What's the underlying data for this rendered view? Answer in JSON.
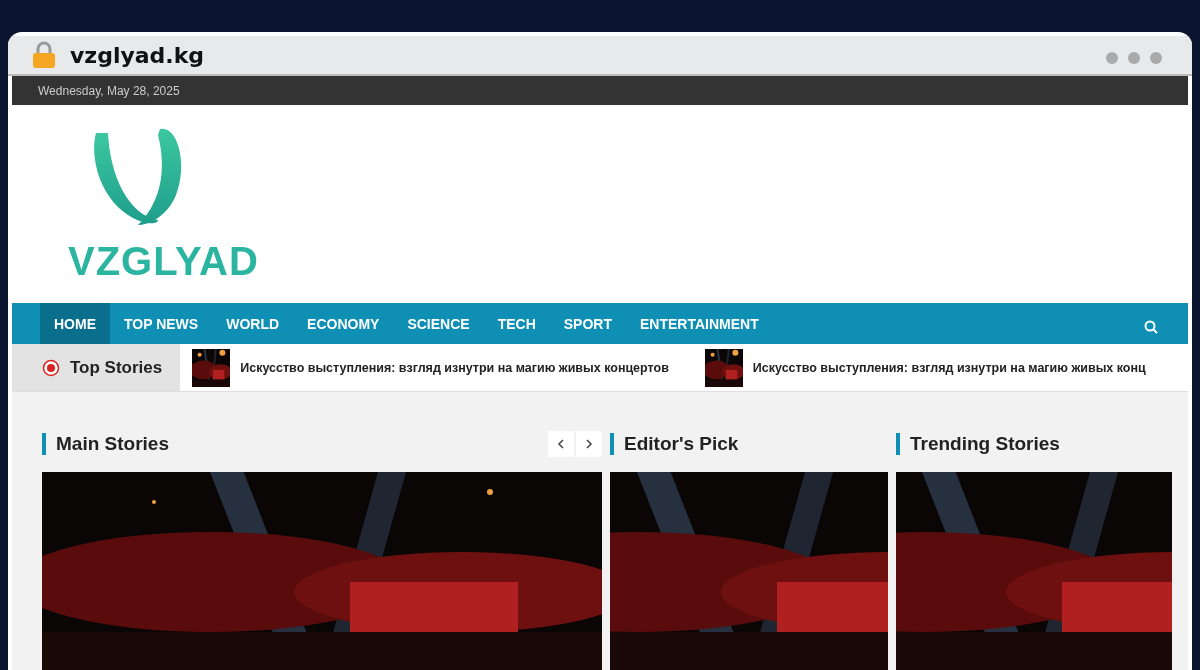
{
  "browser": {
    "url": "vzglyad.kg"
  },
  "top_bar": {
    "date": "Wednesday, May 28, 2025"
  },
  "logo": {
    "text": "VZGLYAD"
  },
  "nav": {
    "items": [
      {
        "label": "HOME",
        "selected": true
      },
      {
        "label": "TOP NEWS",
        "selected": false
      },
      {
        "label": "WORLD",
        "selected": false
      },
      {
        "label": "ECONOMY",
        "selected": false
      },
      {
        "label": "SCIENCE",
        "selected": false
      },
      {
        "label": "TECH",
        "selected": false
      },
      {
        "label": "SPORT",
        "selected": false
      },
      {
        "label": "ENTERTAINMENT",
        "selected": false
      }
    ]
  },
  "ticker": {
    "label": "Top Stories",
    "items": [
      {
        "title": "Искусство выступления: взгляд изнутри на магию живых концертов",
        "kind": "picture"
      },
      {
        "title": "Искусство выступления: взгляд изнутри на магию живых конц",
        "kind": "picture"
      }
    ]
  },
  "sections": [
    {
      "title": "Main Stories",
      "carousel": true
    },
    {
      "title": "Editor's Pick",
      "carousel": false
    },
    {
      "title": "Trending Stories",
      "carousel": false
    }
  ]
}
